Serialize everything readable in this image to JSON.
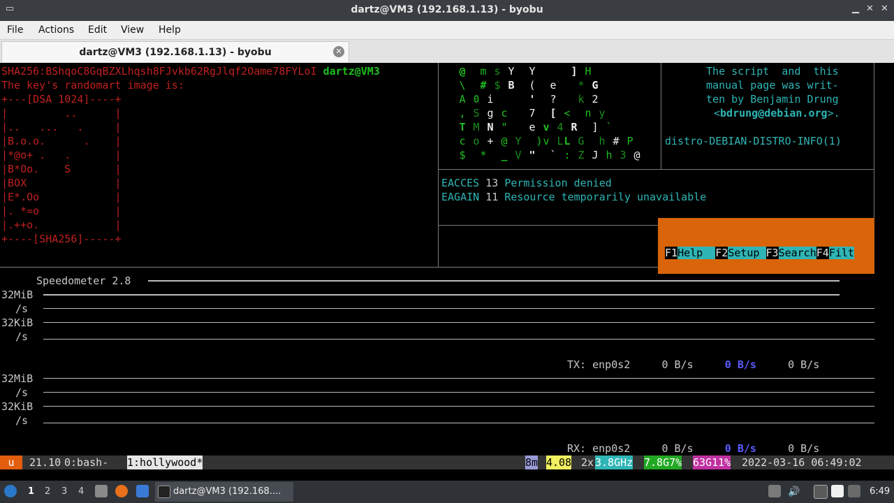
{
  "window": {
    "title": "dartz@VM3 (192.168.1.13) - byobu"
  },
  "menu": [
    "File",
    "Actions",
    "Edit",
    "View",
    "Help"
  ],
  "tab": {
    "label": "dartz@VM3 (192.168.1.13) - byobu"
  },
  "ssh": {
    "fingerprint": "SHA256:BShqoC8GqBZXLhqsh8FJvkb62RgJlqf2Oame78FYLoI",
    "user_host": "dartz@VM3",
    "randomart_header": "The key's randomart image is:",
    "art": [
      "+---[DSA 1024]----+",
      "|         ..      |",
      "|..   ...   .     |",
      "|B.o.o.      .    |",
      "|*@o+ .   .       |",
      "|B*Oo.    S       |",
      "|BOX              |",
      "|E*.Oo            |",
      "|. *=o            |",
      "|.++o.            |",
      "+----[SHA256]-----+"
    ]
  },
  "manpage": {
    "lines": [
      " The script  and  this",
      " manual page was writ-",
      " ten by Benjamin Drung",
      "<"
    ],
    "email": "bdrung@debian.org",
    "email_tail": ">.",
    "footer": "distro-DEBIAN-DISTRO-INFO(1)"
  },
  "errno": [
    {
      "name": "EACCES",
      "num": "13",
      "desc": "Permission denied"
    },
    {
      "name": "EAGAIN",
      "num": "11",
      "desc": "Resource temporarily unavailable"
    }
  ],
  "htop": {
    "fkeys": [
      {
        "key": "F1",
        "label": "Help  "
      },
      {
        "key": "F2",
        "label": "Setup "
      },
      {
        "key": "F3",
        "label": "Search"
      },
      {
        "key": "F4",
        "label": "Filt"
      }
    ]
  },
  "speedometer": {
    "title": "Speedometer 2.8",
    "scale_labels": [
      "32MiB",
      "/s",
      "32KiB",
      "/s",
      "32MiB",
      "/s",
      "32KiB",
      "/s"
    ],
    "tx": {
      "label": "TX: enp0s2",
      "v1": "0 B/s",
      "v2": "0 B/s",
      "v3": "0 B/s"
    },
    "rx": {
      "label": "RX: enp0s2",
      "v1": "0 B/s",
      "v2": "0 B/s",
      "v3": "0 B/s"
    }
  },
  "status": {
    "logo": "u",
    "version": "21.10",
    "win0": "0:bash-",
    "win1": "1:hollywood*",
    "uptime": "8m",
    "load": "4.08",
    "cpu_count": "2x",
    "cpu_freq": "3.8GHz",
    "mem": "7.8G7%",
    "disk": "63G11%",
    "datetime": "2022-03-16 06:49:02"
  },
  "taskbar": {
    "workspaces": [
      "1",
      "2",
      "3",
      "4"
    ],
    "app_label": "dartz@VM3 (192.168....",
    "time": "6:49"
  }
}
